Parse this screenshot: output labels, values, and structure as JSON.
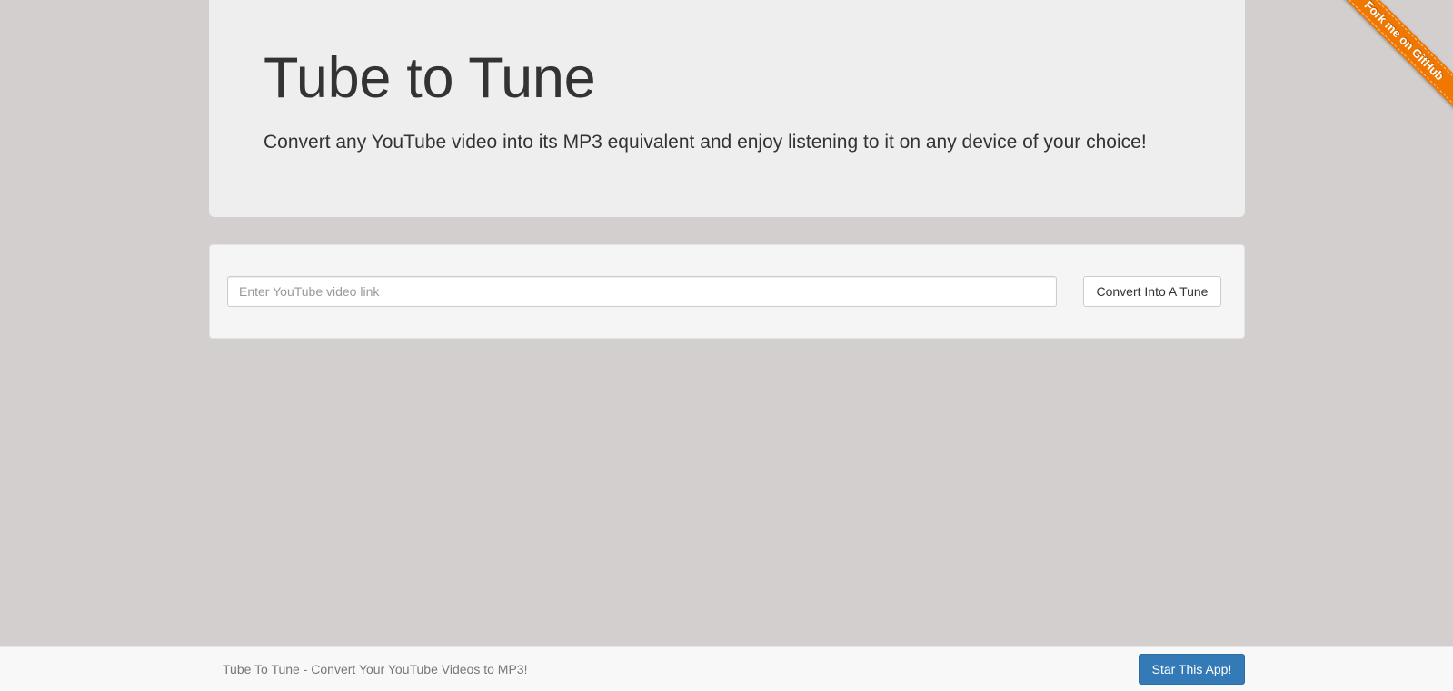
{
  "header": {
    "title": "Tube to Tune",
    "subtitle": "Convert any YouTube video into its MP3 equivalent and enjoy listening to it on any device of your choice!"
  },
  "converter": {
    "input_value": "",
    "input_placeholder": "Enter YouTube video link",
    "button_label": "Convert Into A Tune"
  },
  "footer": {
    "text": "Tube To Tune - Convert Your YouTube Videos to MP3!",
    "star_button_label": "Star This App!"
  },
  "ribbon": {
    "label": "Fork me on GitHub"
  },
  "colors": {
    "page_background": "#d3cfce",
    "jumbotron_background": "#eeeeee",
    "well_background": "#f5f5f5",
    "primary_button": "#337ab7",
    "ribbon": "#f07800"
  }
}
